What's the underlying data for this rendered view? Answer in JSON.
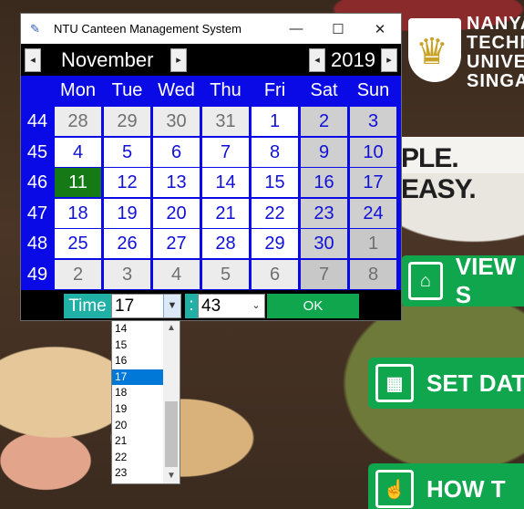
{
  "background": {
    "brand_lines": [
      "NANYA",
      "TECHN",
      "UNIVE",
      "SINGA"
    ],
    "slogan": "PLE. EASY.",
    "buttons": [
      {
        "label": "VIEW S",
        "icon": "storefront-icon"
      },
      {
        "label": "SET DAT",
        "icon": "calendar-clock-icon"
      },
      {
        "label": "HOW T",
        "icon": "touch-icon"
      }
    ]
  },
  "window": {
    "title": "NTU Canteen Management System",
    "controls": {
      "minimize": "—",
      "maximize": "☐",
      "close": "✕"
    }
  },
  "calendar": {
    "month": "November",
    "year": "2019",
    "prev_arrow": "◂",
    "next_arrow": "▸",
    "weekdays": [
      "Mon",
      "Tue",
      "Wed",
      "Thu",
      "Fri",
      "Sat",
      "Sun"
    ],
    "weeks": [
      {
        "week": "44",
        "days": [
          "28",
          "29",
          "30",
          "31",
          "1",
          "2",
          "3"
        ]
      },
      {
        "week": "45",
        "days": [
          "4",
          "5",
          "6",
          "7",
          "8",
          "9",
          "10"
        ]
      },
      {
        "week": "46",
        "days": [
          "11",
          "12",
          "13",
          "14",
          "15",
          "16",
          "17"
        ]
      },
      {
        "week": "47",
        "days": [
          "18",
          "19",
          "20",
          "21",
          "22",
          "23",
          "24"
        ]
      },
      {
        "week": "48",
        "days": [
          "25",
          "26",
          "27",
          "28",
          "29",
          "30",
          "1"
        ]
      },
      {
        "week": "49",
        "days": [
          "2",
          "3",
          "4",
          "5",
          "6",
          "7",
          "8"
        ]
      }
    ],
    "selected_day": "11"
  },
  "time": {
    "label": "Time",
    "hour": "17",
    "separator": ":",
    "minute": "43",
    "ok_label": "OK"
  },
  "hour_dropdown": {
    "items": [
      "14",
      "15",
      "16",
      "17",
      "18",
      "19",
      "20",
      "21",
      "22",
      "23"
    ],
    "selected": "17"
  },
  "colors": {
    "accent_green": "#0fa64e",
    "calendar_blue": "#0a0ae6",
    "selected_day": "#157a15",
    "teal_label": "#20b0a6"
  }
}
